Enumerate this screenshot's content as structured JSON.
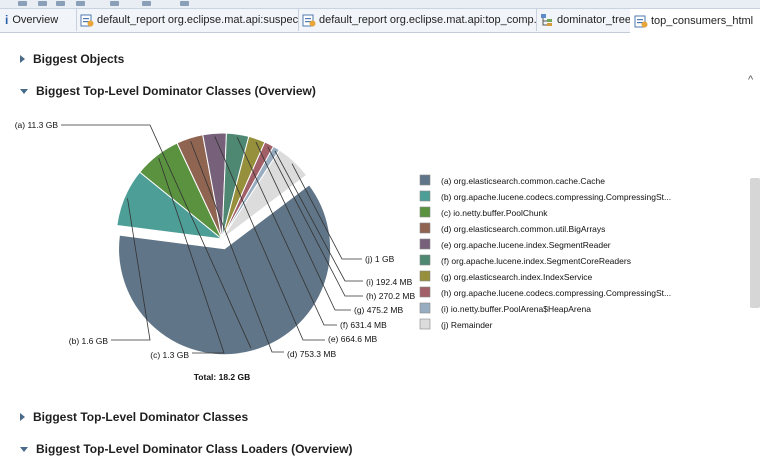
{
  "tabs": [
    {
      "label": "Overview",
      "icon": "info-icon"
    },
    {
      "label": "default_report  org.eclipse.mat.api:suspects",
      "icon": "report-icon"
    },
    {
      "label": "default_report  org.eclipse.mat.api:top_comp...",
      "icon": "report-icon"
    },
    {
      "label": "dominator_tree",
      "icon": "tree-icon"
    },
    {
      "label": "top_consumers_html",
      "icon": "report-icon",
      "active": true,
      "close": "☒"
    }
  ],
  "sections": [
    {
      "label": "Biggest Objects",
      "expanded": false
    },
    {
      "label": "Biggest Top-Level Dominator Classes (Overview)",
      "expanded": true
    },
    {
      "label": "Biggest Top-Level Dominator Classes",
      "expanded": false
    },
    {
      "label": "Biggest Top-Level Dominator Class Loaders (Overview)",
      "expanded": true
    }
  ],
  "chart_data": {
    "type": "pie",
    "total_label": "Total: 18.2 GB",
    "slices": [
      {
        "letter": "(a)",
        "label": "11.3 GB",
        "value": 11570,
        "name": "org.elasticsearch.common.cache.Cache",
        "color": "#607587"
      },
      {
        "letter": "(b)",
        "label": "1.6 GB",
        "value": 1640,
        "name": "org.apache.lucene.codecs.compressing.CompressingSt...",
        "color": "#4e9e98"
      },
      {
        "letter": "(c)",
        "label": "1.3 GB",
        "value": 1330,
        "name": "io.netty.buffer.PoolChunk",
        "color": "#5a9240"
      },
      {
        "letter": "(d)",
        "label": "753.3 MB",
        "value": 753.3,
        "name": "org.elasticsearch.common.util.BigArrays",
        "color": "#8f6552"
      },
      {
        "letter": "(e)",
        "label": "664.6 MB",
        "value": 664.6,
        "name": "org.apache.lucene.index.SegmentReader",
        "color": "#76607a"
      },
      {
        "letter": "(f)",
        "label": "631.4 MB",
        "value": 631.4,
        "name": "org.apache.lucene.index.SegmentCoreReaders",
        "color": "#4e8772"
      },
      {
        "letter": "(g)",
        "label": "475.2 MB",
        "value": 475.2,
        "name": "org.elasticsearch.index.IndexService",
        "color": "#968f3c"
      },
      {
        "letter": "(h)",
        "label": "270.2 MB",
        "value": 270.2,
        "name": "org.apache.lucene.codecs.compressing.CompressingSt...",
        "color": "#a15f68"
      },
      {
        "letter": "(i)",
        "label": "192.4 MB",
        "value": 192.4,
        "name": "io.netty.buffer.PoolArena$HeapArena",
        "color": "#98adc0"
      },
      {
        "letter": "(j)",
        "label": "1 GB",
        "value": 1040,
        "name": "Remainder",
        "color": "#dcdcdc"
      }
    ]
  }
}
